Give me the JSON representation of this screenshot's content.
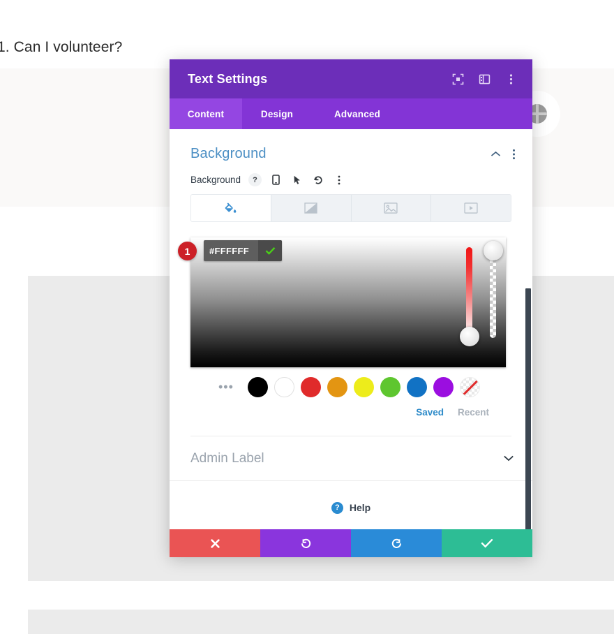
{
  "page": {
    "heading": "1. Can I volunteer?",
    "globe_icon": "globe-icon"
  },
  "modal": {
    "title": "Text Settings",
    "header_icons": [
      {
        "name": "focus-icon",
        "glyph": "⌐"
      },
      {
        "name": "layout-icon",
        "glyph": "▥"
      },
      {
        "name": "kebab-menu-icon",
        "glyph": "⋮"
      }
    ],
    "tabs": [
      {
        "label": "Content",
        "active": true
      },
      {
        "label": "Design",
        "active": false
      },
      {
        "label": "Advanced",
        "active": false
      }
    ],
    "section": {
      "title": "Background",
      "collapse_icon": "chevron-up-icon",
      "menu_icon": "kebab-menu-icon",
      "field_label": "Background",
      "field_icons": [
        {
          "name": "help-icon",
          "glyph": "?"
        },
        {
          "name": "device-mobile-icon",
          "glyph": "▯"
        },
        {
          "name": "cursor-pointer-icon",
          "glyph": "➤"
        },
        {
          "name": "reset-icon",
          "glyph": "↺"
        },
        {
          "name": "kebab-menu-icon",
          "glyph": "⋮"
        }
      ],
      "bg_tabs": [
        {
          "name": "background-color-tab",
          "icon": "paint-bucket-icon",
          "active": true
        },
        {
          "name": "background-gradient-tab",
          "icon": "gradient-icon",
          "active": false
        },
        {
          "name": "background-image-tab",
          "icon": "image-icon",
          "active": false
        },
        {
          "name": "background-video-tab",
          "icon": "video-icon",
          "active": false
        }
      ]
    },
    "color_picker": {
      "hex_value": "#FFFFFF",
      "hex_placeholder": "#FFFFFF",
      "confirm_icon": "checkmark-icon",
      "step_badge": "1",
      "step_badge_color": "#cc2027",
      "hue_slider": "hue-slider",
      "alpha_slider": "alpha-slider",
      "swatch_more": "•••",
      "swatches": [
        {
          "name": "swatch-black",
          "color": "#000000"
        },
        {
          "name": "swatch-white",
          "color": "#ffffff"
        },
        {
          "name": "swatch-red",
          "color": "#e02b2b"
        },
        {
          "name": "swatch-orange",
          "color": "#e39512"
        },
        {
          "name": "swatch-yellow",
          "color": "#edec1b"
        },
        {
          "name": "swatch-green",
          "color": "#5ec62f"
        },
        {
          "name": "swatch-blue",
          "color": "#1172c4"
        },
        {
          "name": "swatch-purple",
          "color": "#9b0ee0"
        },
        {
          "name": "swatch-none",
          "color": "transparent"
        }
      ],
      "saved_label": "Saved",
      "recent_label": "Recent"
    },
    "admin": {
      "label": "Admin Label",
      "chevron_icon": "chevron-down-icon"
    },
    "help": {
      "label": "Help",
      "icon": "help-circle-icon",
      "mark": "?"
    },
    "footer_buttons": [
      {
        "name": "cancel-button",
        "icon": "close-icon",
        "glyph": "✖",
        "color": "#ea5454"
      },
      {
        "name": "undo-button",
        "icon": "undo-icon",
        "glyph": "↺",
        "color": "#8a35dd"
      },
      {
        "name": "redo-button",
        "icon": "redo-icon",
        "glyph": "↻",
        "color": "#2a8bd8"
      },
      {
        "name": "save-button",
        "icon": "checkmark-icon",
        "glyph": "✔",
        "color": "#2dbd95"
      }
    ],
    "scrollbar": "modal-scrollbar"
  }
}
